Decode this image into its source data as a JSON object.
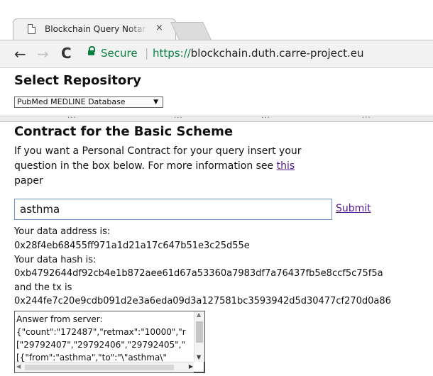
{
  "browser": {
    "tab_title": "Blockchain Query Notar",
    "tab_close": "×",
    "back": "←",
    "forward": "→",
    "reload": "C",
    "secure_label": "Secure",
    "url_scheme": "https://",
    "url_host": "blockchain.duth.carre-project.eu"
  },
  "repository": {
    "title": "Select Repository",
    "selected": "PubMed MEDLINE Database",
    "arrow": "▼"
  },
  "divider": {
    "grip": "• • • •"
  },
  "contract": {
    "title": "Contract for the Basic Scheme",
    "intro_before": "If you want a Personal Contract for your query insert your question in the box below. For more information see ",
    "intro_link": "this",
    "intro_after": " paper",
    "query_value": "asthma",
    "submit_label": "Submit"
  },
  "result": {
    "address_label": "Your data address is:",
    "address_value": "0x28f4eb68455ff971a1d21a17c647b51e3c25d55e",
    "hash_label": "Your data hash is:",
    "hash_value": "0xb4792644df92cb4e1b872aee61d67a53360a7983df7a76437fb5e8ccf5c75f5a",
    "tx_label": "and the tx is",
    "tx_value": "0x244fe7c20e9cdb091d2e3a6eda09d3a127581bc3593942d5d30477cf270d0a86",
    "server_text": "Answer from server:\n{\"count\":\"172487\",\"retmax\":\"10000\",\"r\n[\"29792407\",\"29792406\",\"29792405\",\"\n[{\"from\":\"asthma\",\"to\":\"\\\"asthma\\\""
  }
}
